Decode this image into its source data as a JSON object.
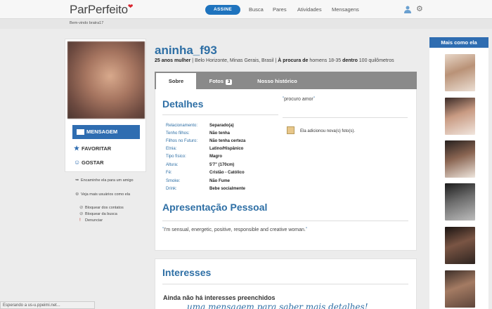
{
  "header": {
    "logo": "ParPerfeito",
    "subscribe_label": "ASSINE",
    "nav": [
      "Busca",
      "Pares",
      "Atividades",
      "Mensagens"
    ],
    "welcome": "Bem-vindo bratra17"
  },
  "profile": {
    "username": "aninha_f93",
    "age_gender": "25 anos mulher",
    "location": " | Belo Horizonte, Minas Gerais, Brasil | ",
    "seeking_label": "À procura de",
    "seeking_value": " homens 18-35 ",
    "within_label": "dentro",
    "within_value": " 100 quilômetros"
  },
  "actions": {
    "message": "MENSAGEM",
    "favorite": "FAVORITAR",
    "like": "GOSTAR",
    "forward": "Encaminhe ela para um amigo",
    "similar": "Veja mais usuários como ela",
    "block_contacts": "Bloquear dos contatos",
    "block_search": "Bloquear da busca",
    "report": "Denunciar"
  },
  "tabs": [
    {
      "label": "Sobre",
      "active": true
    },
    {
      "label": "Fotos",
      "count": "3"
    },
    {
      "label": "Nosso histórico"
    }
  ],
  "details": {
    "title": "Detalhes",
    "rows": [
      {
        "label": "Relacionamento:",
        "value": "Separado(a)"
      },
      {
        "label": "Tenho filhos:",
        "value": "Não tenha"
      },
      {
        "label": "Filhos no Futuro:",
        "value": "Não tenha certeza"
      },
      {
        "label": "Etnia:",
        "value": "Latino/Hispânico"
      },
      {
        "label": "Tipo físico:",
        "value": "Magro"
      },
      {
        "label": "Altura:",
        "value": "5'7\" (170cm)"
      },
      {
        "label": "Fé:",
        "value": "Cristão - Católico"
      },
      {
        "label": "Smoke:",
        "value": "Não Fume"
      },
      {
        "label": "Drink:",
        "value": "Bebe socialmente"
      }
    ]
  },
  "headline_quote": "procuro amor",
  "activity_note": "Ela adicionou nova(s) foto(s).",
  "about": {
    "title": "Apresentação Pessoal",
    "text": "I'm sensual, energetic, positive, responsible and creative woman."
  },
  "interests": {
    "title": "Interesses",
    "empty": "Ainda não há interesses preenchidos",
    "prompt": "uma mensagem para saber mais detalhes!"
  },
  "sidebar": {
    "title": "Mais como ela"
  },
  "status": "Esperando a us-u.ppeimi.net...",
  "colors": {
    "accent": "#2e6fa5",
    "button": "#2f6db1",
    "tab_bar": "#8a8a8a",
    "logo_heart": "#d9232d"
  }
}
